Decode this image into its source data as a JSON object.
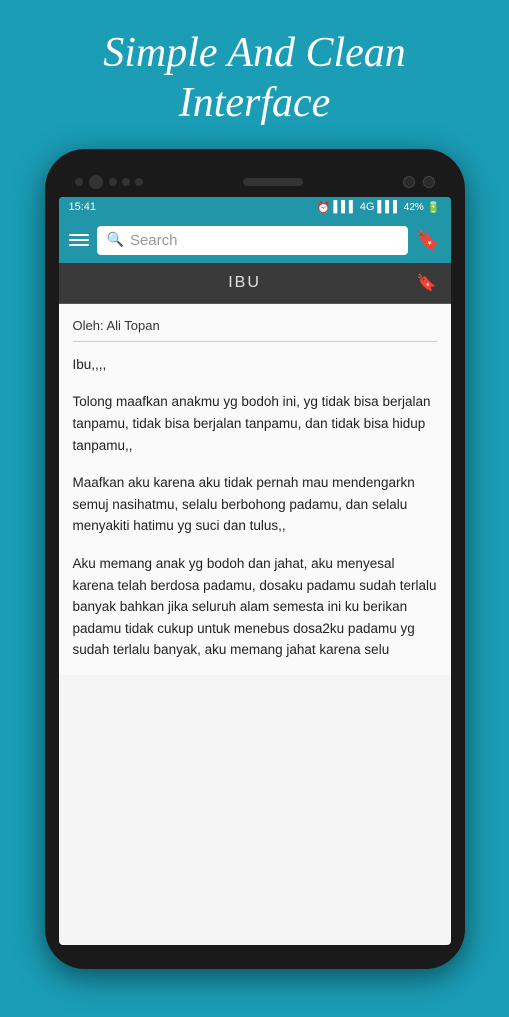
{
  "header": {
    "title": "Simple And Clean Interface"
  },
  "status_bar": {
    "time": "15:41",
    "battery": "42%"
  },
  "toolbar": {
    "search_placeholder": "Search",
    "hamburger_label": "Menu",
    "bookmark_label": "Bookmark"
  },
  "poem": {
    "title": "IBU",
    "author": "Oleh: Ali Topan",
    "paragraphs": [
      "Ibu,,,,",
      "Tolong maafkan anakmu yg bodoh ini, yg tidak bisa berjalan tanpamu, tidak bisa berjalan tanpamu, dan tidak bisa hidup tanpamu,,",
      "Maafkan aku karena aku tidak pernah mau mendengarkn semuj nasihatmu, selalu berbohong padamu, dan selalu menyakiti hatimu yg suci dan tulus,,",
      "Aku memang anak yg bodoh dan jahat, aku menyesal karena telah berdosa padamu, dosaku padamu sudah terlalu banyak bahkan jika seluruh alam semesta ini ku berikan padamu tidak cukup untuk menebus dosa2ku padamu yg sudah terlalu banyak, aku memang jahat karena selu"
    ]
  },
  "icons": {
    "search": "🔍",
    "bookmark": "🔖",
    "hamburger": "☰"
  }
}
